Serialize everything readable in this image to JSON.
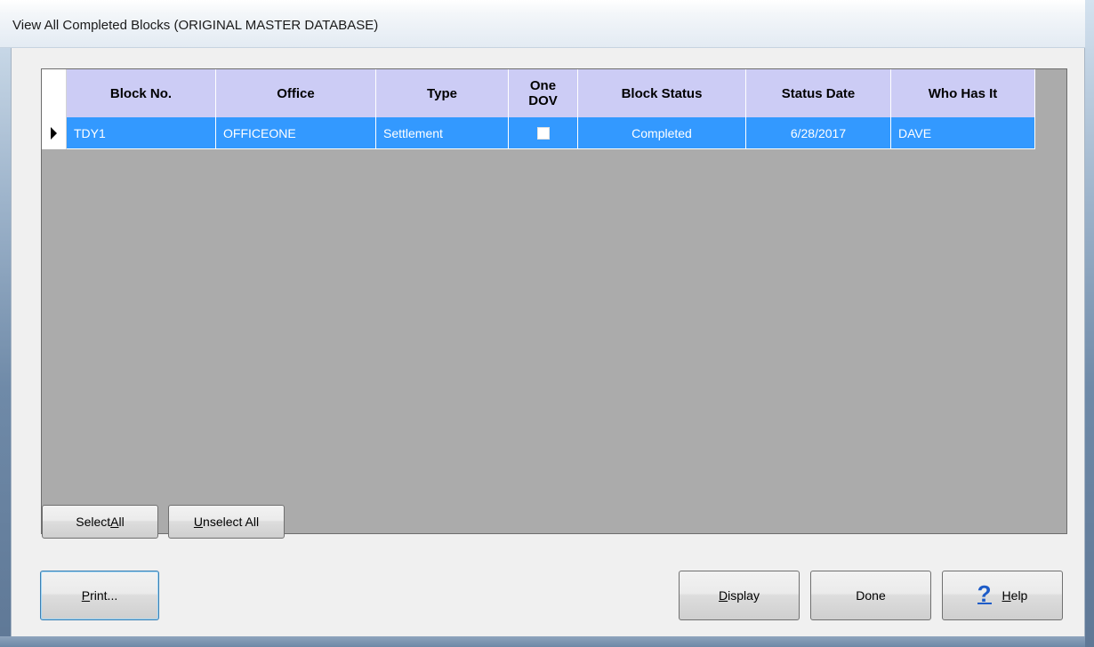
{
  "window": {
    "title": "View All Completed Blocks (ORIGINAL MASTER DATABASE)"
  },
  "grid": {
    "columns": [
      {
        "label": "Block No."
      },
      {
        "label": "Office"
      },
      {
        "label": "Type"
      },
      {
        "label": "One\nDOV"
      },
      {
        "label": "Block Status"
      },
      {
        "label": "Status Date"
      },
      {
        "label": "Who Has It"
      }
    ],
    "rows": [
      {
        "block_no": "TDY1",
        "office": "OFFICEONE",
        "type": "Settlement",
        "one_dov": false,
        "block_status": "Completed",
        "status_date": "6/28/2017",
        "who_has_it": "DAVE",
        "selected": true
      }
    ]
  },
  "buttons": {
    "select_all": {
      "pre": "Select ",
      "accel": "A",
      "post": "ll"
    },
    "unselect_all": {
      "pre": "",
      "accel": "U",
      "post": "nselect All"
    },
    "print": {
      "pre": "",
      "accel": "P",
      "post": "rint..."
    },
    "display": {
      "pre": "",
      "accel": "D",
      "post": "isplay"
    },
    "done": {
      "label": "Done"
    },
    "help": {
      "pre": "",
      "accel": "H",
      "post": "elp",
      "icon": "question-mark-icon"
    }
  },
  "colors": {
    "header_bg": "#ccccf5",
    "selected_row_bg": "#3399ff",
    "grid_bg": "#ababab"
  }
}
